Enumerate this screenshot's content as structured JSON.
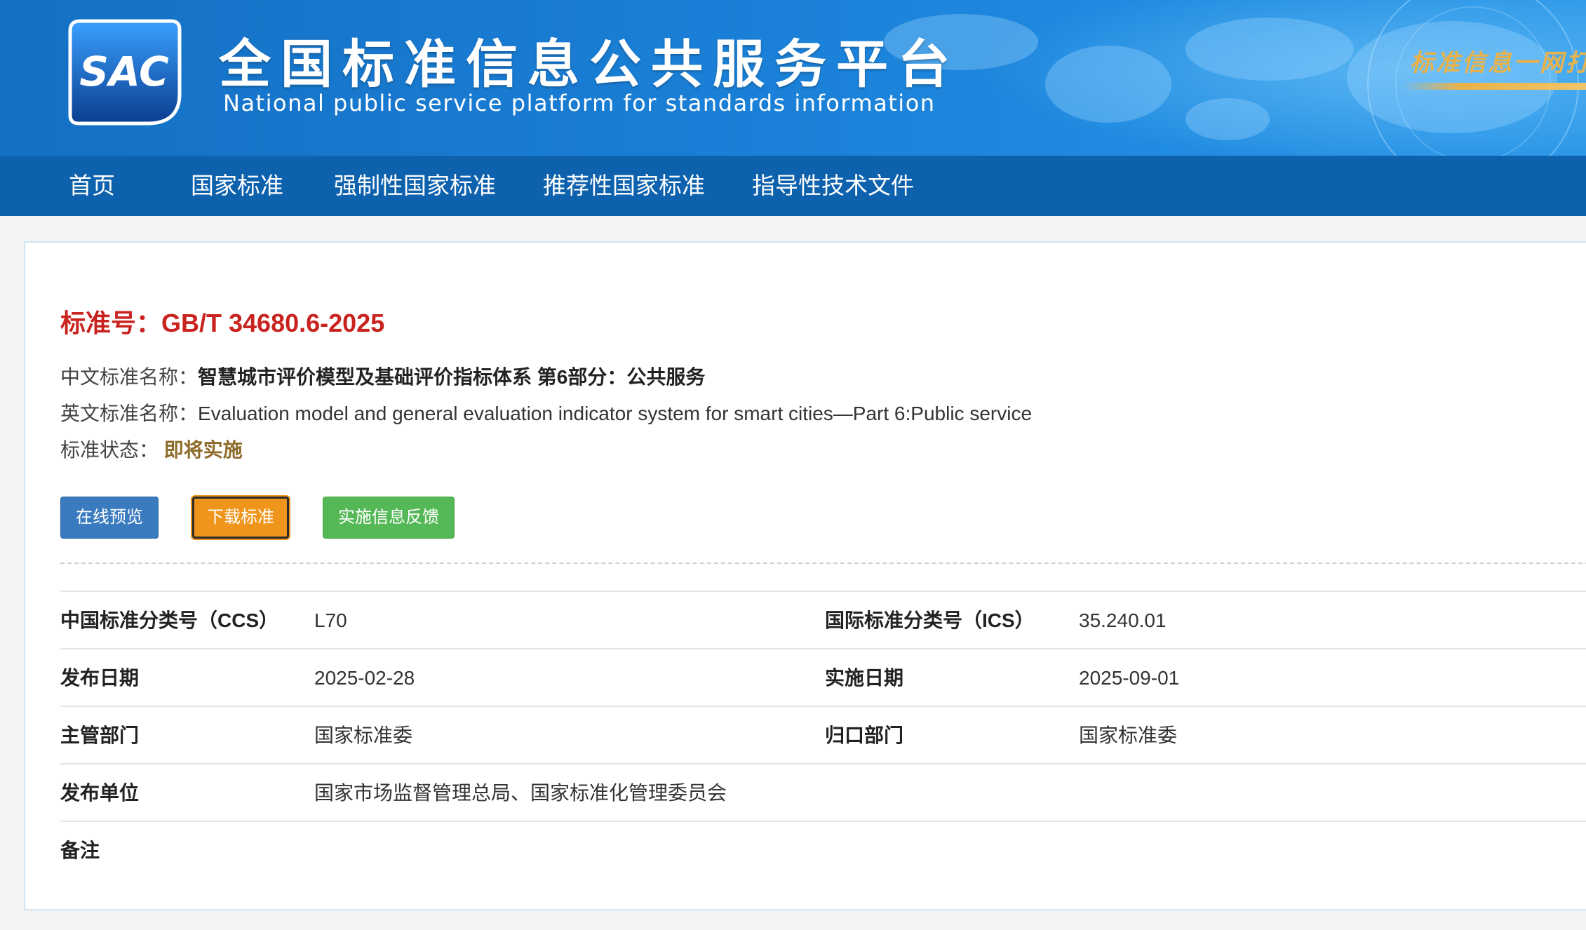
{
  "header": {
    "logo_text": "SAC",
    "title": "全国标准信息公共服务平台",
    "subtitle": "National public service platform  for standards information",
    "slogan": "标准信息一网打尽"
  },
  "nav": {
    "items": [
      {
        "label": "首页"
      },
      {
        "label": "国家标准"
      },
      {
        "label": "强制性国家标准"
      },
      {
        "label": "推荐性国家标准"
      },
      {
        "label": "指导性技术文件"
      }
    ]
  },
  "standard": {
    "number_label": "标准号：",
    "number": "GB/T 34680.6-2025",
    "cn_name_label": "中文标准名称：",
    "cn_name": "智慧城市评价模型及基础评价指标体系  第6部分：公共服务",
    "en_name_label": "英文标准名称：",
    "en_name": "Evaluation model and general evaluation indicator system for smart cities—Part 6:Public service",
    "status_label": "标准状态：",
    "status": "即将实施"
  },
  "actions": {
    "preview": "在线预览",
    "download": "下载标准",
    "feedback": "实施信息反馈"
  },
  "colors": {
    "header_blue": "#1a7fd6",
    "nav_blue": "#0e62ad",
    "std_red": "#c8231e",
    "status_brown": "#8e6b2a",
    "btn_blue": "#3a7bbf",
    "btn_orange": "#f0951b",
    "btn_green": "#55b856"
  },
  "info": {
    "ccs_label": "中国标准分类号（CCS）",
    "ccs": "L70",
    "ics_label": "国际标准分类号（ICS）",
    "ics": "35.240.01",
    "publish_date_label": "发布日期",
    "publish_date": "2025-02-28",
    "impl_date_label": "实施日期",
    "impl_date": "2025-09-01",
    "dept_label": "主管部门",
    "dept": "国家标准委",
    "tc_label": "归口部门",
    "tc": "国家标准委",
    "publisher_label": "发布单位",
    "publisher": "国家市场监督管理总局、国家标准化管理委员会",
    "remark_label": "备注",
    "remark": ""
  }
}
